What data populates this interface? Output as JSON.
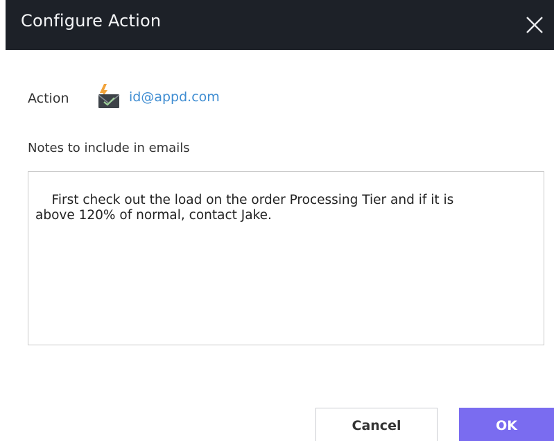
{
  "dialog": {
    "title": "Configure Action"
  },
  "action": {
    "label": "Action",
    "icon": "email-action-icon",
    "link_text": "id@appd.com"
  },
  "notes": {
    "label": "Notes to include in emails",
    "value": "First check out the load on the order Processing Tier and if it is\nabove 120% of normal, contact Jake."
  },
  "buttons": {
    "cancel_label": "Cancel",
    "ok_label": "OK"
  },
  "colors": {
    "titlebar_bg": "#1d2128",
    "link": "#3f8dd2",
    "ok_button": "#7a6cf0"
  }
}
